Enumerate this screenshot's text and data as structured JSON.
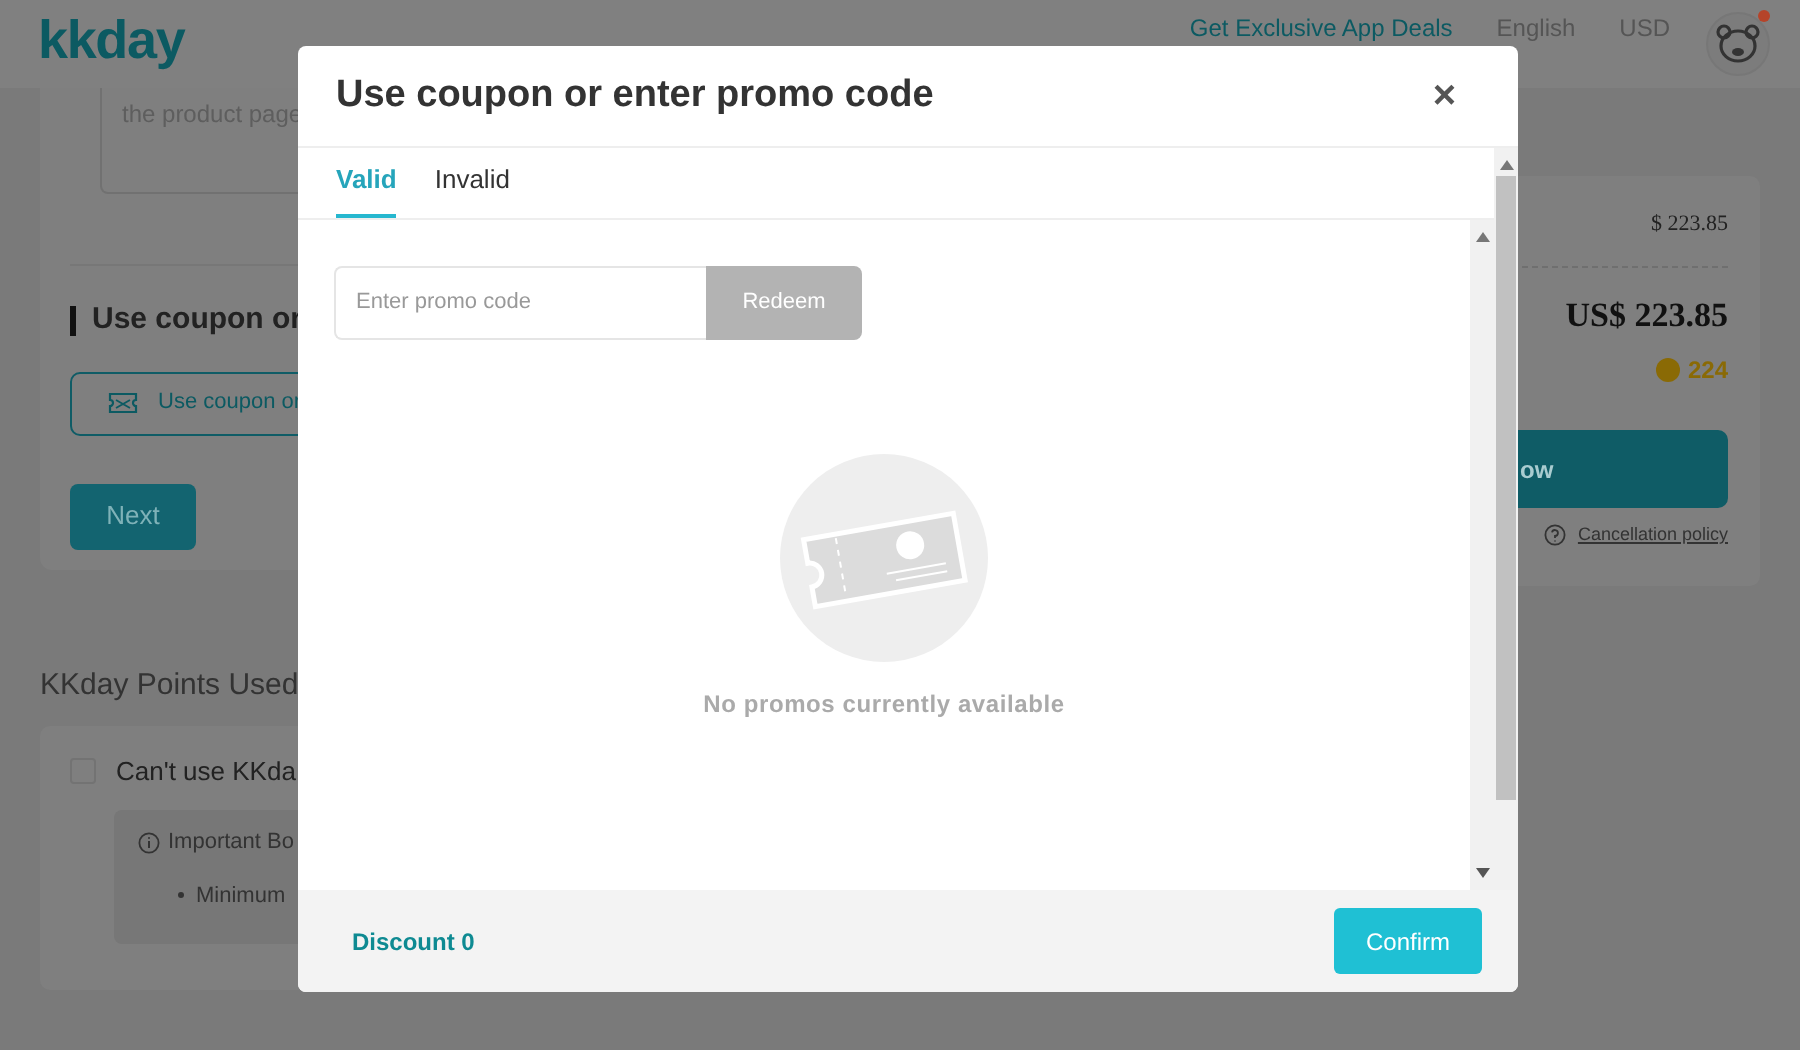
{
  "header": {
    "logo": "kkday",
    "app_deals": "Get Exclusive App Deals",
    "language": "English",
    "currency": "USD",
    "notification": true
  },
  "background": {
    "product_note": "the product page",
    "coupon_heading": "Use coupon or",
    "coupon_button": "Use coupon or",
    "next_button": "Next",
    "points_heading": "KKday Points Used",
    "points_option": {
      "label": "Can't use KKda",
      "checked": false
    },
    "notice_title": "Important Bo",
    "notice_item": "Minimum",
    "subtotal": "$ 223.85",
    "total": "US$ 223.85",
    "points_earned": "224",
    "book_button": "ow",
    "cancellation": "Cancellation policy"
  },
  "modal": {
    "title": "Use coupon or enter promo code",
    "close": "×",
    "tabs": [
      {
        "label": "Valid",
        "selected": true
      },
      {
        "label": "Invalid",
        "selected": false
      }
    ],
    "promo": {
      "placeholder": "Enter promo code",
      "button": "Redeem",
      "disabled": true
    },
    "empty_message": "No promos currently available",
    "discount": "Discount 0",
    "confirm": "Confirm"
  }
}
